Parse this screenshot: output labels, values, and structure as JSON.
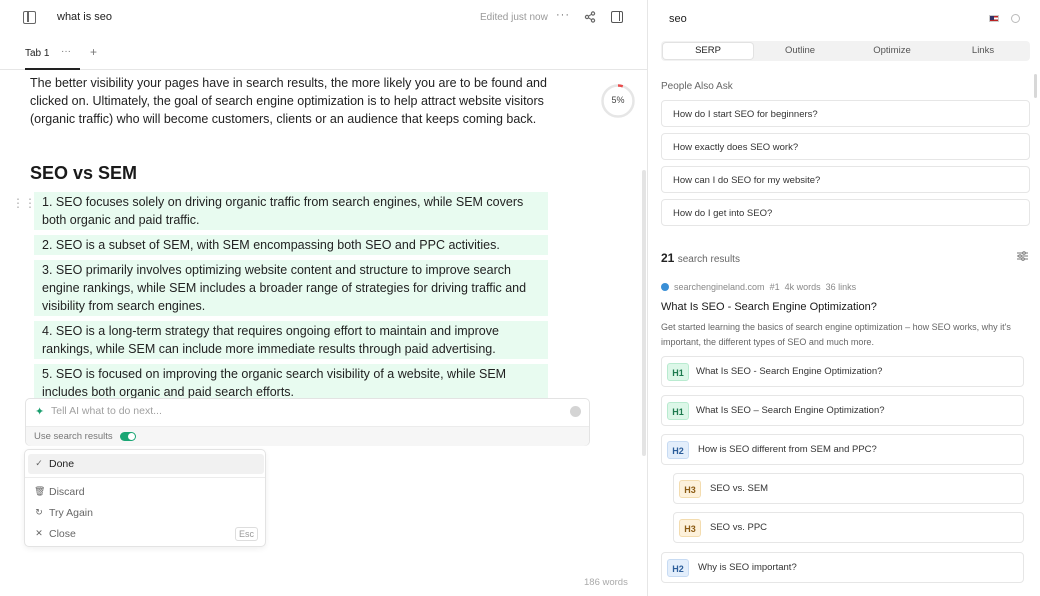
{
  "header": {
    "doc_title": "what is seo",
    "edited_status": "Edited just now",
    "more_label": "···"
  },
  "tabs": [
    {
      "label": "Tab 1"
    }
  ],
  "tabbar": {
    "more_label": "···",
    "add_label": "+"
  },
  "document": {
    "intro_paragraph": "The better visibility your pages have in search results, the more likely you are to be found and clicked on. Ultimately, the goal of search engine optimization is to help attract website visitors (organic traffic) who will become customers, clients or an audience that keeps coming back.",
    "heading": "SEO vs SEM",
    "list_items": [
      "1. SEO focuses solely on driving organic traffic from search engines, while SEM covers both organic and paid traffic.",
      "2. SEO is a subset of SEM, with SEM encompassing both SEO and PPC activities.",
      "3. SEO primarily involves optimizing website content and structure to improve search engine rankings, while SEM includes a broader range of strategies for driving traffic and visibility from search engines.",
      "4. SEO is a long-term strategy that requires ongoing effort to maintain and improve rankings, while SEM can include more immediate results through paid advertising.",
      "5. SEO is focused on improving the organic search visibility of a website, while SEM includes both organic and paid search efforts."
    ],
    "score_label": "5%",
    "score_fraction": 0.05,
    "word_count": "186 words"
  },
  "ai_prompt": {
    "placeholder": "Tell AI what to do next...",
    "use_search_label": "Use search results",
    "use_search_enabled": true
  },
  "ai_menu": {
    "items": [
      {
        "label": "Done",
        "icon": "check-icon"
      },
      {
        "label": "Discard",
        "icon": "trash-icon"
      },
      {
        "label": "Try Again",
        "icon": "refresh-icon"
      },
      {
        "label": "Close",
        "icon": "close-icon",
        "shortcut": "Esc"
      }
    ]
  },
  "sidebar": {
    "keyword": "seo",
    "tabs": [
      {
        "label": "SERP",
        "active": true
      },
      {
        "label": "Outline",
        "active": false
      },
      {
        "label": "Optimize",
        "active": false
      },
      {
        "label": "Links",
        "active": false
      }
    ],
    "paa_title": "People Also Ask",
    "paa_items": [
      "How do I start SEO for beginners?",
      "How exactly does SEO work?",
      "How can I do SEO for my website?",
      "How do I get into SEO?"
    ],
    "results_count": "21",
    "results_suffix": "search results",
    "result": {
      "domain": "searchengineland.com",
      "rank": "#1",
      "words": "4k words",
      "links": "36 links",
      "title": "What Is SEO - Search Engine Optimization?",
      "description": "Get started learning the basics of search engine optimization – how SEO works, why it's important, the different types of SEO and much more.",
      "headings": [
        {
          "level": "H1",
          "text": "What Is SEO - Search Engine Optimization?"
        },
        {
          "level": "H1",
          "text": "What Is SEO – Search Engine Optimization?"
        },
        {
          "level": "H2",
          "text": "How is SEO different from SEM and PPC?"
        },
        {
          "level": "H3",
          "text": "SEO vs. SEM"
        },
        {
          "level": "H3",
          "text": "SEO vs. PPC"
        },
        {
          "level": "H2",
          "text": "Why is SEO important?"
        }
      ]
    }
  },
  "colors": {
    "accent_green": "#1aa674",
    "list_highlight": "#e8fbf0",
    "progress_ring": "#e94b4b"
  }
}
